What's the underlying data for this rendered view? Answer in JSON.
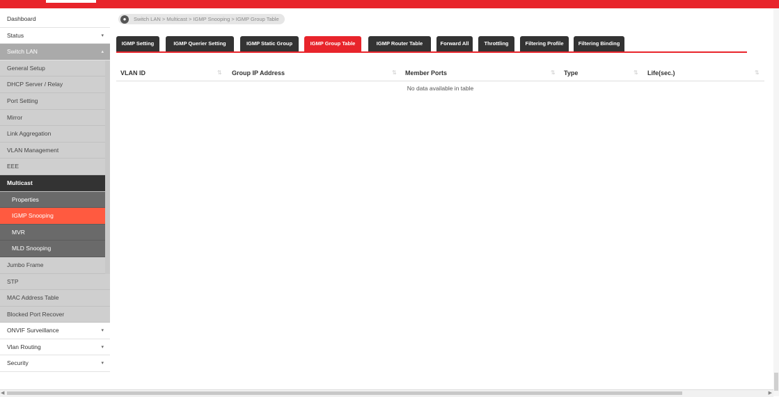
{
  "breadcrumb": "Switch LAN > Multicast > IGMP Snooping > IGMP Group Table",
  "sidebar": {
    "dashboard": "Dashboard",
    "status": "Status",
    "switch_lan": "Switch LAN",
    "general_setup": "General Setup",
    "dhcp": "DHCP Server / Relay",
    "port_setting": "Port Setting",
    "mirror": "Mirror",
    "link_aggregation": "Link Aggregation",
    "vlan_management": "VLAN Management",
    "eee": "EEE",
    "multicast": "Multicast",
    "properties": "Properties",
    "igmp_snooping": "IGMP Snooping",
    "mvr": "MVR",
    "mld_snooping": "MLD Snooping",
    "jumbo_frame": "Jumbo Frame",
    "stp": "STP",
    "mac_table": "MAC Address Table",
    "blocked_port": "Blocked Port Recover",
    "onvif": "ONVIF Surveillance",
    "vlan_routing": "Vlan Routing",
    "security": "Security"
  },
  "tabs": {
    "t1": "IGMP Setting",
    "t2": "IGMP Querier Setting",
    "t3": "IGMP Static Group",
    "t4": "IGMP Group Table",
    "t5": "IGMP Router Table",
    "t6": "Forward All",
    "t7": "Throttling",
    "t8": "Filtering Profile",
    "t9": "Filtering Binding"
  },
  "table": {
    "col_vlan": "VLAN ID",
    "col_group": "Group IP Address",
    "col_member": "Member Ports",
    "col_type": "Type",
    "col_life": "Life(sec.)",
    "empty": "No data available in table"
  }
}
